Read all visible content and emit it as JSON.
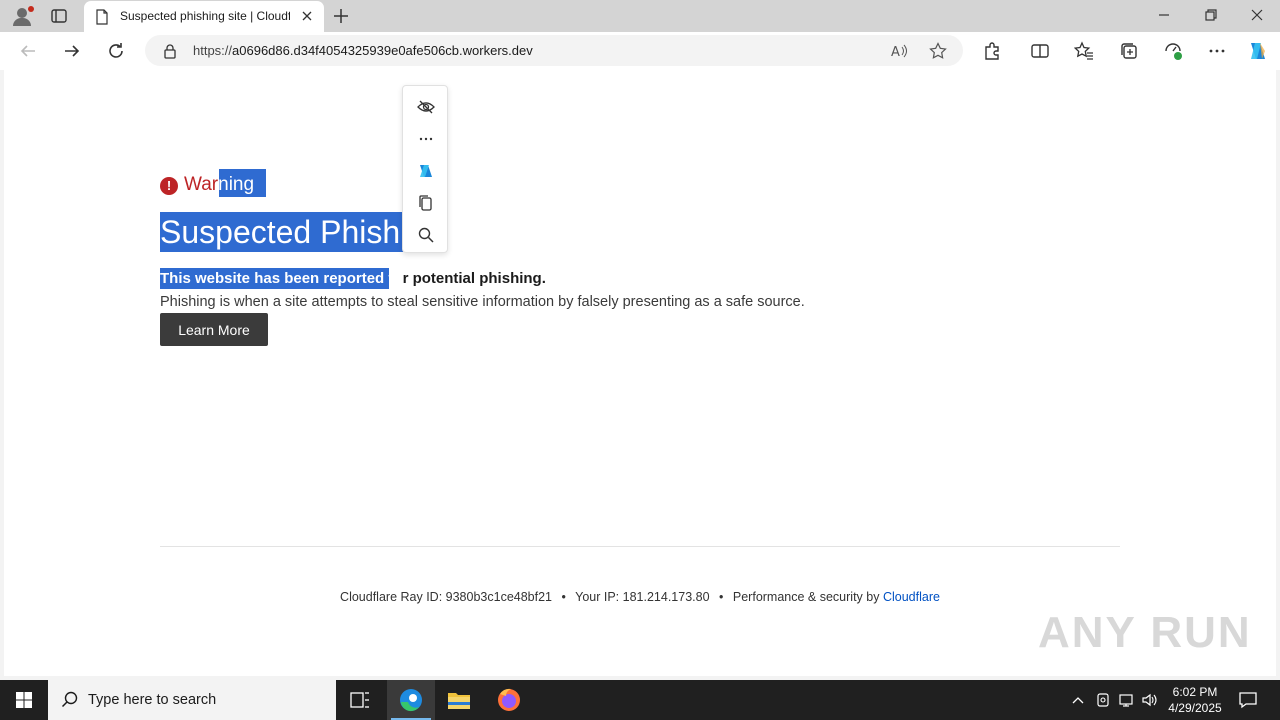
{
  "browser": {
    "tab_title": "Suspected phishing site | Cloudflare",
    "url_prefix": "https://",
    "url_host": "a0696d86.d34f4054325939e0afe506cb.workers.dev"
  },
  "page": {
    "warning_label_a": "War",
    "warning_label_b": "ning",
    "heading": "Suspected Phishin",
    "subheading_selected": "This website has been reported fo",
    "subheading_rest": "r potential phishing.",
    "description": "Phishing is when a site attempts to steal sensitive information by falsely presenting as a safe source.",
    "learn_more": "Learn More",
    "footer": {
      "ray_label": "Cloudflare Ray ID:",
      "ray_id": "9380b3c1ce48bf21",
      "sep1": "•",
      "ip_label": "Your IP:",
      "ip": "181.214.173.80",
      "sep2": "•",
      "perf_label": "Performance & security by",
      "perf_link": "Cloudflare"
    }
  },
  "watermark": "ANY RUN",
  "taskbar": {
    "search_placeholder": "Type here to search",
    "time": "6:02 PM",
    "date": "4/29/2025"
  },
  "colors": {
    "warning_red": "#bd2426",
    "selection_blue": "#2f6bd1",
    "link_blue": "#0051c3",
    "button_dark": "#3b3b3b"
  },
  "icons": [
    "hide-icon",
    "more-icon",
    "copilot-icon",
    "copy-icon",
    "search-icon"
  ]
}
